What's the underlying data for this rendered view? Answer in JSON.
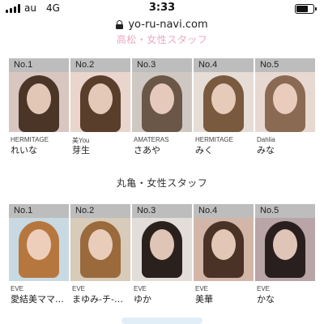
{
  "status_bar": {
    "carrier": "au",
    "network": "4G",
    "time": "3:33",
    "battery_level": 0.75
  },
  "browser": {
    "url": "yo-ru-navi.com"
  },
  "section_top": {
    "title": "高松・女性スタッフ"
  },
  "section_marugame": {
    "title": "丸亀・女性スタッフ"
  },
  "row1": [
    {
      "rank": "No.1",
      "shop": "HERMITAGE",
      "name": "れいな",
      "hair": "#4a3527",
      "bg": "#d9c6c0"
    },
    {
      "rank": "No.2",
      "shop": "美You",
      "name": "芽生",
      "hair": "#5a3e2c",
      "bg": "#e9d5cc"
    },
    {
      "rank": "No.3",
      "shop": "AMATERAS",
      "name": "さあや",
      "hair": "#6b5747",
      "bg": "#cfc8c2"
    },
    {
      "rank": "No.4",
      "shop": "HERMITAGE",
      "name": "みく",
      "hair": "#7a5a3f",
      "bg": "#e5ddd6"
    },
    {
      "rank": "No.5",
      "shop": "Dahlia",
      "name": "みな",
      "hair": "#8a6a52",
      "bg": "#e8d8d2"
    }
  ],
  "row2": [
    {
      "rank": "No.1",
      "shop": "EVE",
      "name": "愛結美ママ…",
      "hair": "#b6773f",
      "bg": "#c8d9e2"
    },
    {
      "rank": "No.2",
      "shop": "EVE",
      "name": "まゆみ-チ-…",
      "hair": "#9a6a3c",
      "bg": "#d8cbb9"
    },
    {
      "rank": "No.3",
      "shop": "EVE",
      "name": "ゆか",
      "hair": "#2b211c",
      "bg": "#e2ddd8"
    },
    {
      "rank": "No.4",
      "shop": "EVE",
      "name": "美華",
      "hair": "#4a3226",
      "bg": "#d4b6a8"
    },
    {
      "rank": "No.5",
      "shop": "EVE",
      "name": "かな",
      "hair": "#2a1f1f",
      "bg": "#b9a4a7"
    }
  ]
}
